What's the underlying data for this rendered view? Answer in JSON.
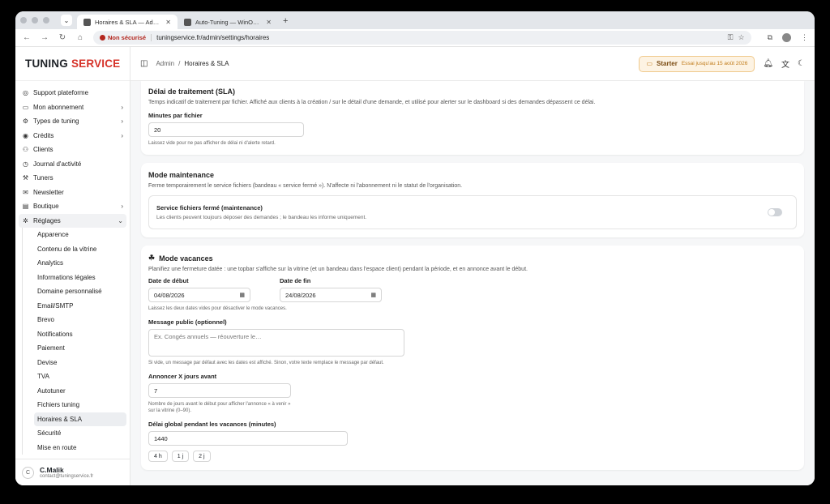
{
  "browser": {
    "tabs": [
      {
        "title": "Horaires & SLA — Admin · Tu",
        "active": true
      },
      {
        "title": "Auto-Tuning — WinOLS, proj",
        "active": false
      }
    ],
    "security_label": "Non sécurisé",
    "url": "tuningservice.fr/admin/settings/horaires"
  },
  "brand": {
    "part1": "TUNING",
    "part2": "SERVICE",
    "accent": "#d6332a"
  },
  "sidebar": {
    "items": [
      {
        "label": "Support plateforme",
        "icon": "help-icon",
        "chev": ""
      },
      {
        "label": "Mon abonnement",
        "icon": "card-icon",
        "chev": "›"
      },
      {
        "label": "Types de tuning",
        "icon": "gear-icon",
        "chev": "›"
      },
      {
        "label": "Crédits",
        "icon": "coin-icon",
        "chev": "›"
      },
      {
        "label": "Clients",
        "icon": "users-icon",
        "chev": ""
      },
      {
        "label": "Journal d'activité",
        "icon": "history-icon",
        "chev": ""
      },
      {
        "label": "Tuners",
        "icon": "wrench-icon",
        "chev": ""
      },
      {
        "label": "Newsletter",
        "icon": "mail-icon",
        "chev": ""
      },
      {
        "label": "Boutique",
        "icon": "shop-icon",
        "chev": "›"
      },
      {
        "label": "Réglages",
        "icon": "settings-icon",
        "chev": "⌄"
      }
    ],
    "sub_items": [
      "Apparence",
      "Contenu de la vitrine",
      "Analytics",
      "Informations légales",
      "Domaine personnalisé",
      "Email/SMTP",
      "Brevo",
      "Notifications",
      "Paiement",
      "Devise",
      "TVA",
      "Autotuner",
      "Fichiers tuning",
      "Horaires & SLA",
      "Sécurité",
      "Mise en route"
    ],
    "active_sub": "Horaires & SLA"
  },
  "user": {
    "initial": "C",
    "name": "C.Malik",
    "email": "contact@tuningservice.fr"
  },
  "topbar": {
    "crumb_root": "Admin",
    "crumb_sep": "/",
    "crumb_current": "Horaires & SLA",
    "plan": "Starter",
    "trial": "Essai jusqu'au 15 août 2026"
  },
  "sla": {
    "title": "Délai de traitement (SLA)",
    "desc": "Temps indicatif de traitement par fichier. Affiché aux clients à la création / sur le détail d'une demande, et utilisé pour alerter sur le dashboard si des demandes dépassent ce délai.",
    "field_label": "Minutes par fichier",
    "value": "20",
    "hint": "Laissez vide pour ne pas afficher de délai ni d'alerte retard."
  },
  "maintenance": {
    "title": "Mode maintenance",
    "desc": "Ferme temporairement le service fichiers (bandeau « service fermé »). N'affecte ni l'abonnement ni le statut de l'organisation.",
    "toggle_title": "Service fichiers fermé (maintenance)",
    "toggle_desc": "Les clients peuvent toujours déposer des demandes ; le bandeau les informe uniquement.",
    "enabled": false
  },
  "vacation": {
    "title": "Mode vacances",
    "desc": "Planifiez une fermeture datée : une topbar s'affiche sur la vitrine (et un bandeau dans l'espace client) pendant la période, et en annonce avant le début.",
    "start_label": "Date de début",
    "start_value": "04/08/2026",
    "end_label": "Date de fin",
    "end_value": "24/08/2026",
    "dates_hint": "Laissez les deux dates vides pour désactiver le mode vacances.",
    "message_label": "Message public (optionnel)",
    "message_placeholder": "Ex. Congés annuels — réouverture le…",
    "message_hint": "Si vide, un message par défaut avec les dates est affiché. Sinon, votre texte remplace le message par défaut.",
    "announce_label": "Annoncer X jours avant",
    "announce_value": "7",
    "announce_hint": "Nombre de jours avant le début pour afficher l'annonce « à venir » sur la vitrine (0–90).",
    "delay_label": "Délai global pendant les vacances (minutes)",
    "delay_value": "1440",
    "chips": [
      "4 h",
      "1 j",
      "2 j"
    ]
  }
}
